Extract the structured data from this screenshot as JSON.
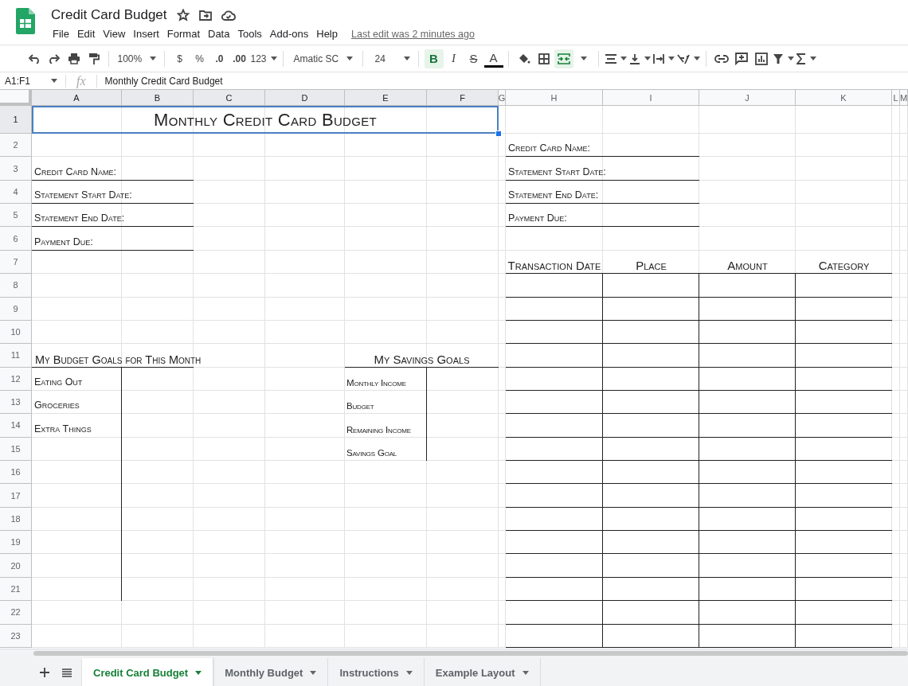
{
  "document": {
    "title": "Credit Card Budget",
    "last_edit": "Last edit was 2 minutes ago"
  },
  "menu": [
    "File",
    "Edit",
    "View",
    "Insert",
    "Format",
    "Data",
    "Tools",
    "Add-ons",
    "Help"
  ],
  "toolbar": {
    "zoom": "100%",
    "currency": "$",
    "percent": "%",
    "decrease_decimals": ".0",
    "increase_decimals": ".00",
    "more_formats": "123",
    "font": "Amatic SC",
    "font_size": "24",
    "bold": {
      "label": "B",
      "on": true
    },
    "italic": {
      "label": "I",
      "on": false
    },
    "strikethrough": {
      "label": "S",
      "on": false
    },
    "text_color": {
      "label": "A"
    },
    "merge_on": true
  },
  "formula_bar": {
    "range": "A1:F1",
    "fx": "fx",
    "content": "Monthly Credit Card Budget"
  },
  "sheet": {
    "columns": [
      "A",
      "B",
      "C",
      "D",
      "E",
      "F",
      "G",
      "H",
      "I",
      "J",
      "K",
      "L",
      "M"
    ],
    "rows": [
      "1",
      "2",
      "3",
      "4",
      "5",
      "6",
      "7",
      "8",
      "9",
      "10",
      "11",
      "12",
      "13",
      "14",
      "15",
      "16",
      "17",
      "18",
      "19",
      "20",
      "21",
      "22",
      "23"
    ],
    "title": {
      "text": "Monthly Credit Card Budget",
      "selected": true
    },
    "card_info_left": [
      "Credit Card Name:",
      "Statement Start Date:",
      "Statement End Date:",
      "Payment Due:"
    ],
    "card_info_right": [
      "Credit Card Name:",
      "Statement Start Date:",
      "Statement End Date:",
      "Payment Due:"
    ],
    "budget_goals": {
      "title": "My Budget Goals for This Month",
      "items": [
        "Eating Out",
        "Groceries",
        "Extra Things"
      ]
    },
    "savings_goals": {
      "title": "My Savings Goals",
      "items": [
        "Monthly Income",
        "Budget",
        "Remaining Income",
        "Savings Goal"
      ]
    },
    "transactions": {
      "columns": [
        "Transaction Date",
        "Place",
        "Amount",
        "Category"
      ]
    }
  },
  "sheet_tabs": [
    {
      "label": "Credit Card Budget",
      "selected": true
    },
    {
      "label": "Monthly Budget",
      "selected": false
    },
    {
      "label": "Instructions",
      "selected": false
    },
    {
      "label": "Example Layout",
      "selected": false
    }
  ]
}
